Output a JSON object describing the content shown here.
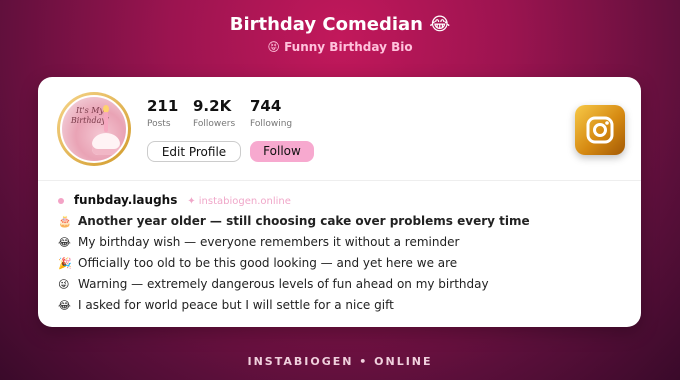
{
  "header": {
    "title": "Birthday Comedian 😂",
    "subtitle": "😝 Funny Birthday Bio"
  },
  "profile": {
    "avatar_text": "It's My Birthday!",
    "stats": [
      {
        "value": "211",
        "label": "Posts"
      },
      {
        "value": "9.2K",
        "label": "Followers"
      },
      {
        "value": "744",
        "label": "Following"
      }
    ],
    "edit_label": "Edit Profile",
    "follow_label": "Follow",
    "username": "funbday.laughs",
    "website": "✦ instabiogen.online"
  },
  "bio": [
    {
      "icon": "🎂",
      "text": "Another year older — still choosing cake over problems every time"
    },
    {
      "icon": "😂",
      "text": "My birthday wish — everyone remembers it without a reminder"
    },
    {
      "icon": "🎉",
      "text": "Officially too old to be this good looking — and yet here we are"
    },
    {
      "icon": "😜",
      "text": "Warning — extremely dangerous levels of fun ahead on my birthday"
    },
    {
      "icon": "😂",
      "text": "I asked for world peace but I will settle for a nice gift"
    }
  ],
  "footer": {
    "text": "INSTABIOGEN • ONLINE"
  },
  "colors": {
    "accent": "#f7a9cf",
    "background": "#9c1450"
  }
}
